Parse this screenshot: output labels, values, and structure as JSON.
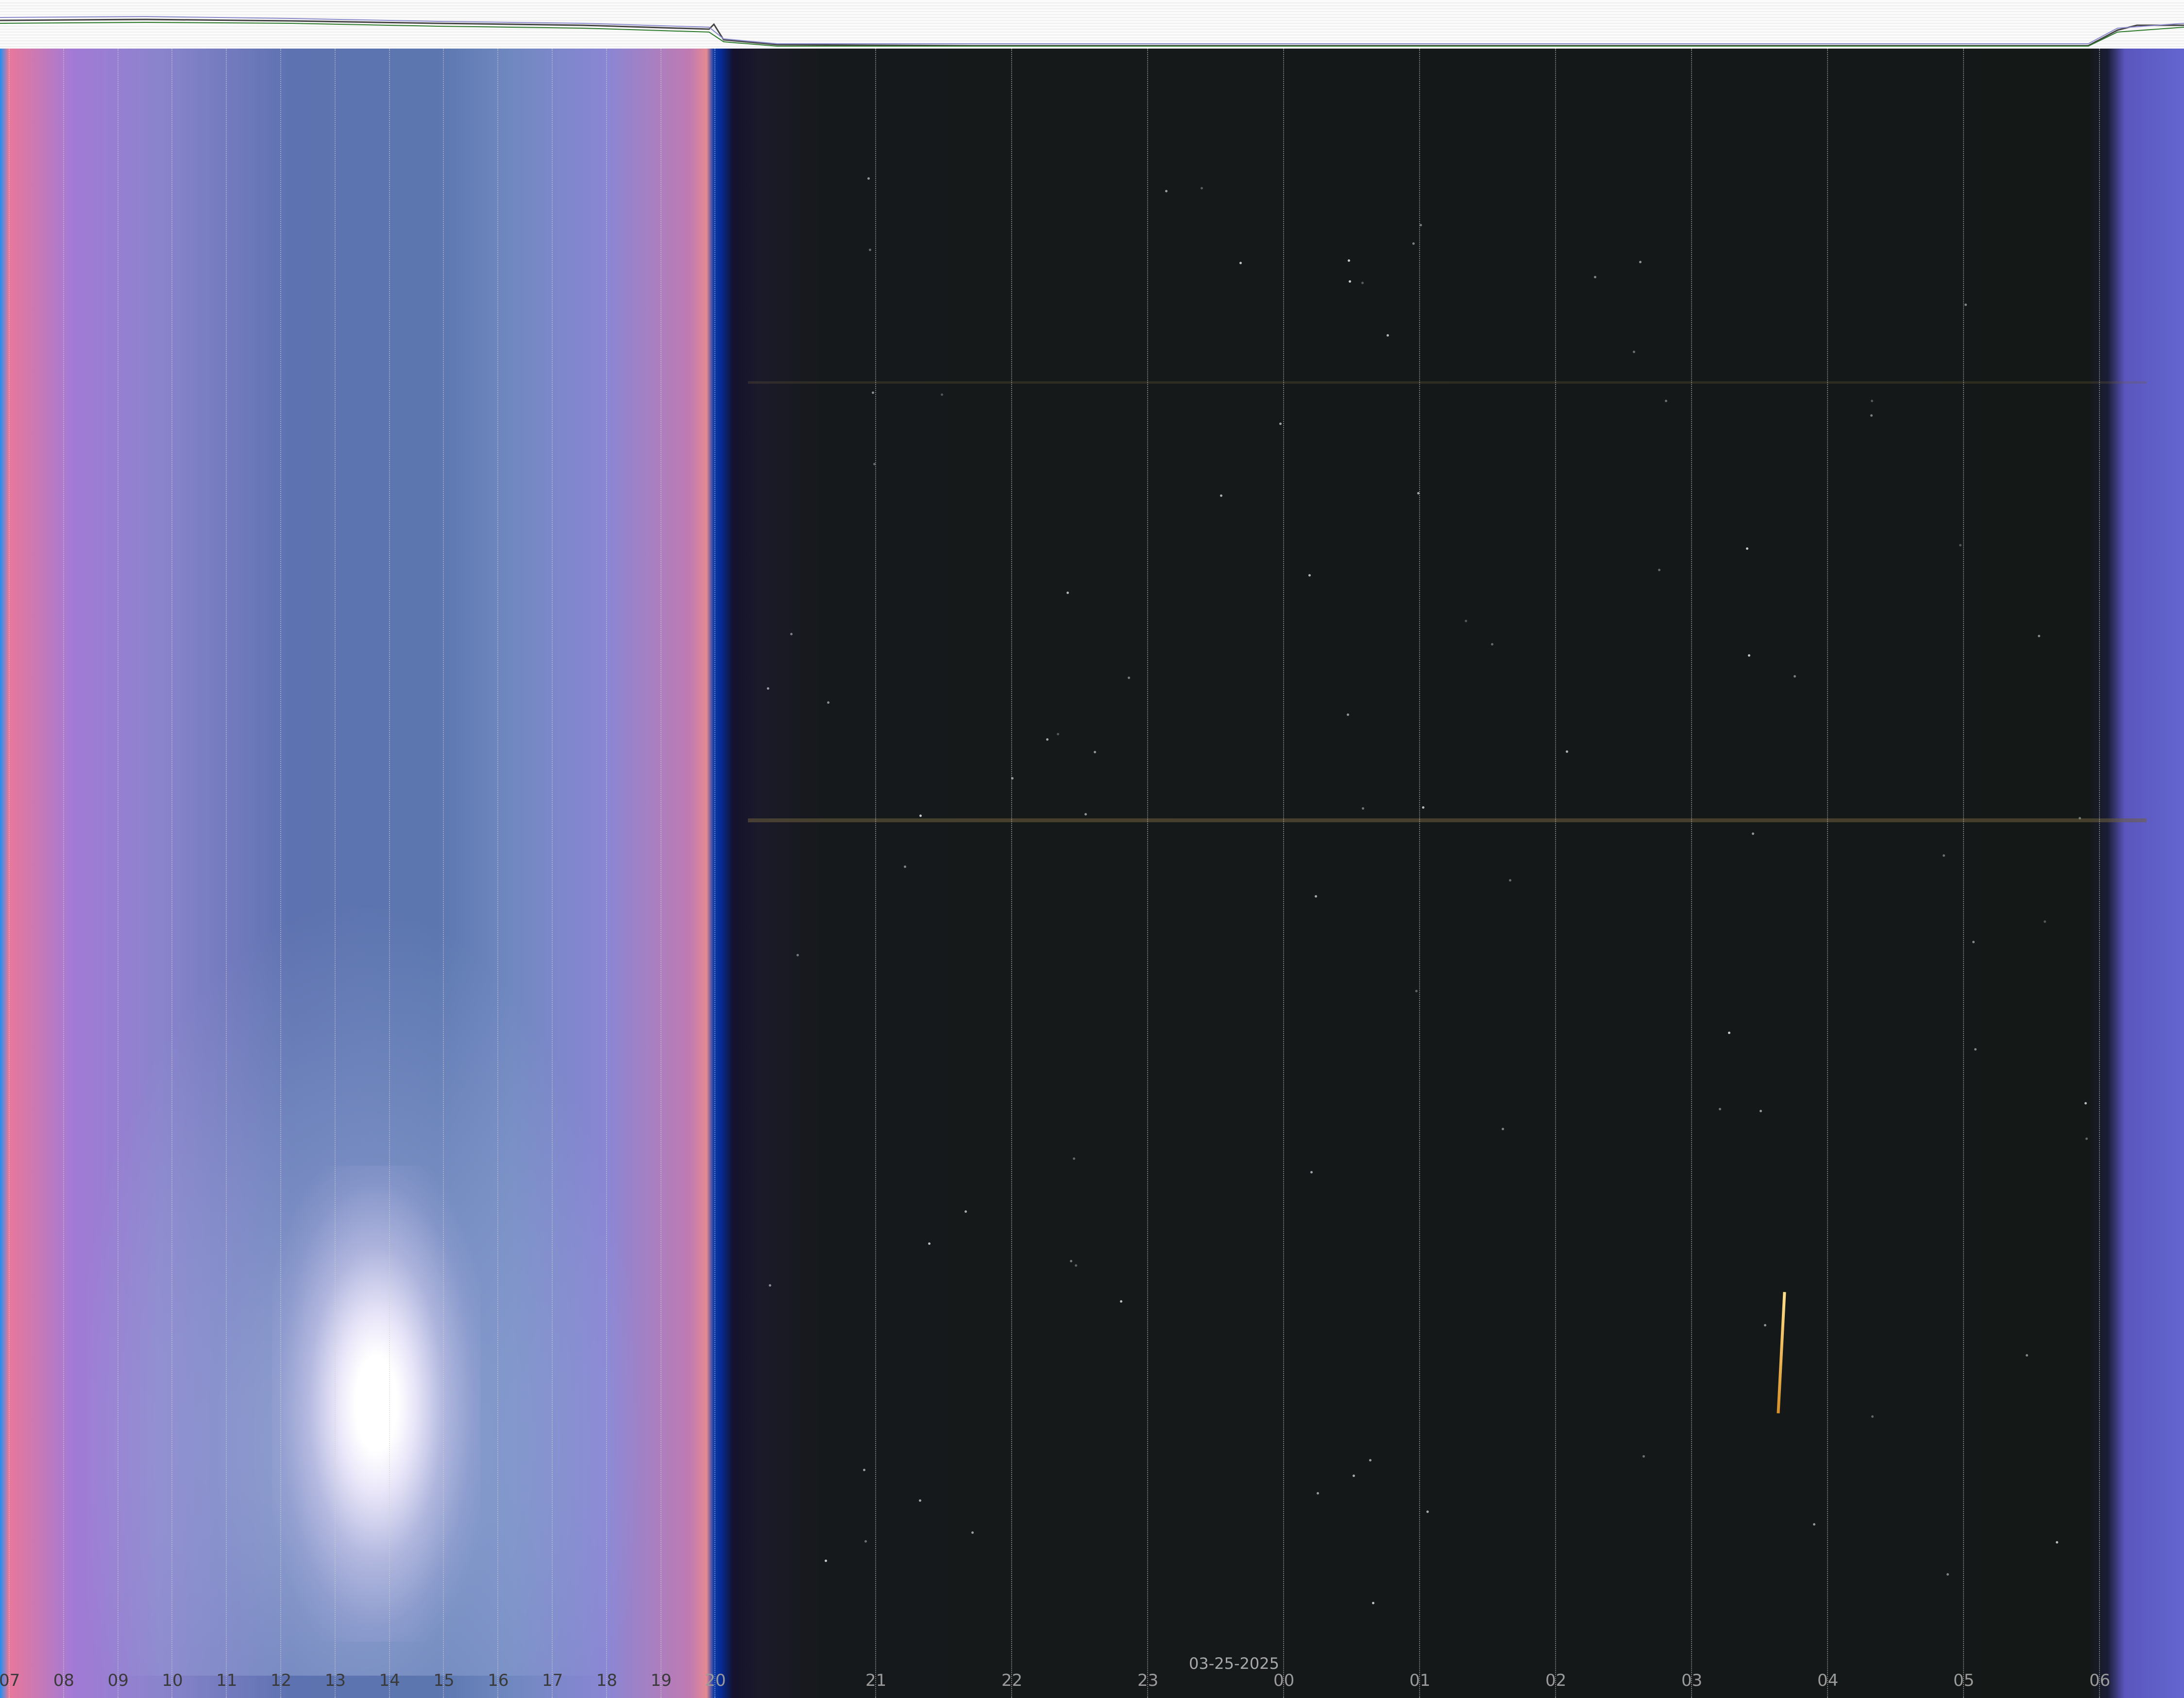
{
  "date_label": "03-25-2025",
  "hour_labels": [
    "07",
    "08",
    "09",
    "10",
    "11",
    "12",
    "13",
    "14",
    "15",
    "16",
    "17",
    "18",
    "19",
    "20",
    "21",
    "22",
    "23",
    "00",
    "01",
    "02",
    "03",
    "04",
    "05",
    "06"
  ],
  "colors": {
    "day_sky": "#5c77b0",
    "night_sky": "#141817",
    "twilight_blue": "#0a3aa8",
    "sun_glare": "#ffffff",
    "horizon_band": "#6e5f3c"
  },
  "top_strip": {
    "description_series_colors": [
      "#444444",
      "#2a7a2a",
      "#8888cc",
      "#aa66aa"
    ]
  }
}
